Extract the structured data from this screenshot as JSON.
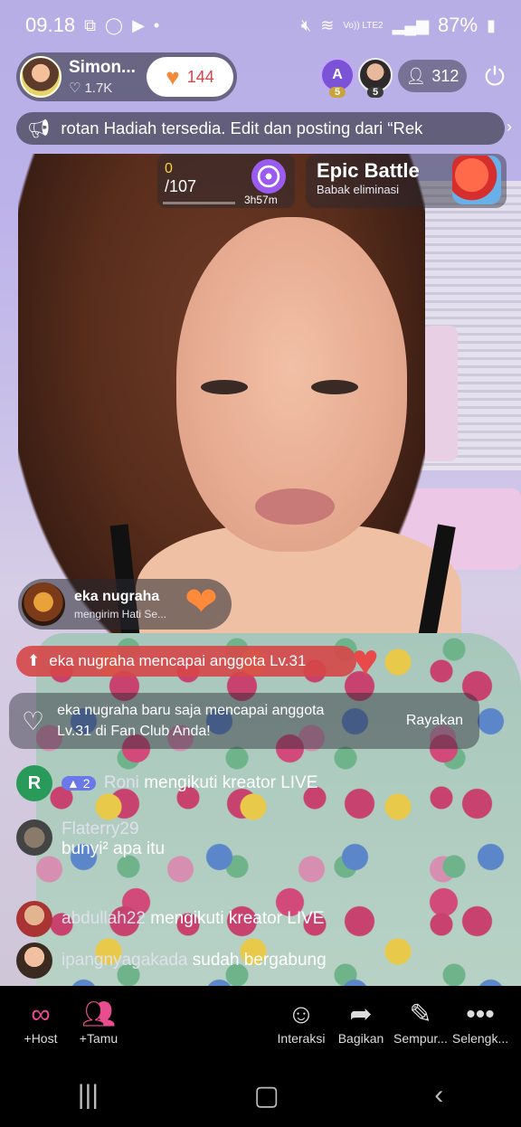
{
  "status": {
    "time": "09.18",
    "battery": "87%",
    "net": "Vo)) LTE2"
  },
  "host": {
    "name": "Simon...",
    "likes": "1.7K",
    "hearts": "144"
  },
  "viewers": {
    "av1_letter": "A",
    "av1_level": "5",
    "av2_level": "5",
    "count": "312"
  },
  "announcement": "rotan Hadiah tersedia. Edit dan posting dari “Rek",
  "goal": {
    "current": "0",
    "total": "/107",
    "time": "3h57m"
  },
  "battle": {
    "title": "Epic Battle",
    "subtitle": "Babak eliminasi"
  },
  "gift": {
    "user": "eka nugraha",
    "text": "mengirim Hati Se..."
  },
  "level_banner": "eka nugraha mencapai anggota Lv.31",
  "fanclub": {
    "text": "eka nugraha baru saja mencapai anggota Lv.31 di Fan Club Anda!",
    "button": "Rayakan"
  },
  "chat": [
    {
      "avatar": "R",
      "badge": "2",
      "user": "Roni",
      "text": "mengikuti kreator LIVE"
    },
    {
      "user": "Flaterry29",
      "text": "bunyi² apa itu"
    },
    {
      "user": "abdullah22",
      "text": "mengikuti kreator LIVE"
    },
    {
      "user": "ipangnyagakada",
      "text": "sudah bergabung"
    }
  ],
  "toolbar": [
    {
      "label": "+Host",
      "icon": "link-icon"
    },
    {
      "label": "+Tamu",
      "icon": "guests-icon"
    },
    {
      "label": "Interaksi",
      "icon": "interaction-icon"
    },
    {
      "label": "Bagikan",
      "icon": "share-icon"
    },
    {
      "label": "Sempur...",
      "icon": "magic-wand-icon"
    },
    {
      "label": "Selengk...",
      "icon": "more-icon"
    }
  ],
  "colors": {
    "accent": "#e94d8f",
    "level_banner": "#d64648",
    "gold": "#ffcf3a"
  }
}
